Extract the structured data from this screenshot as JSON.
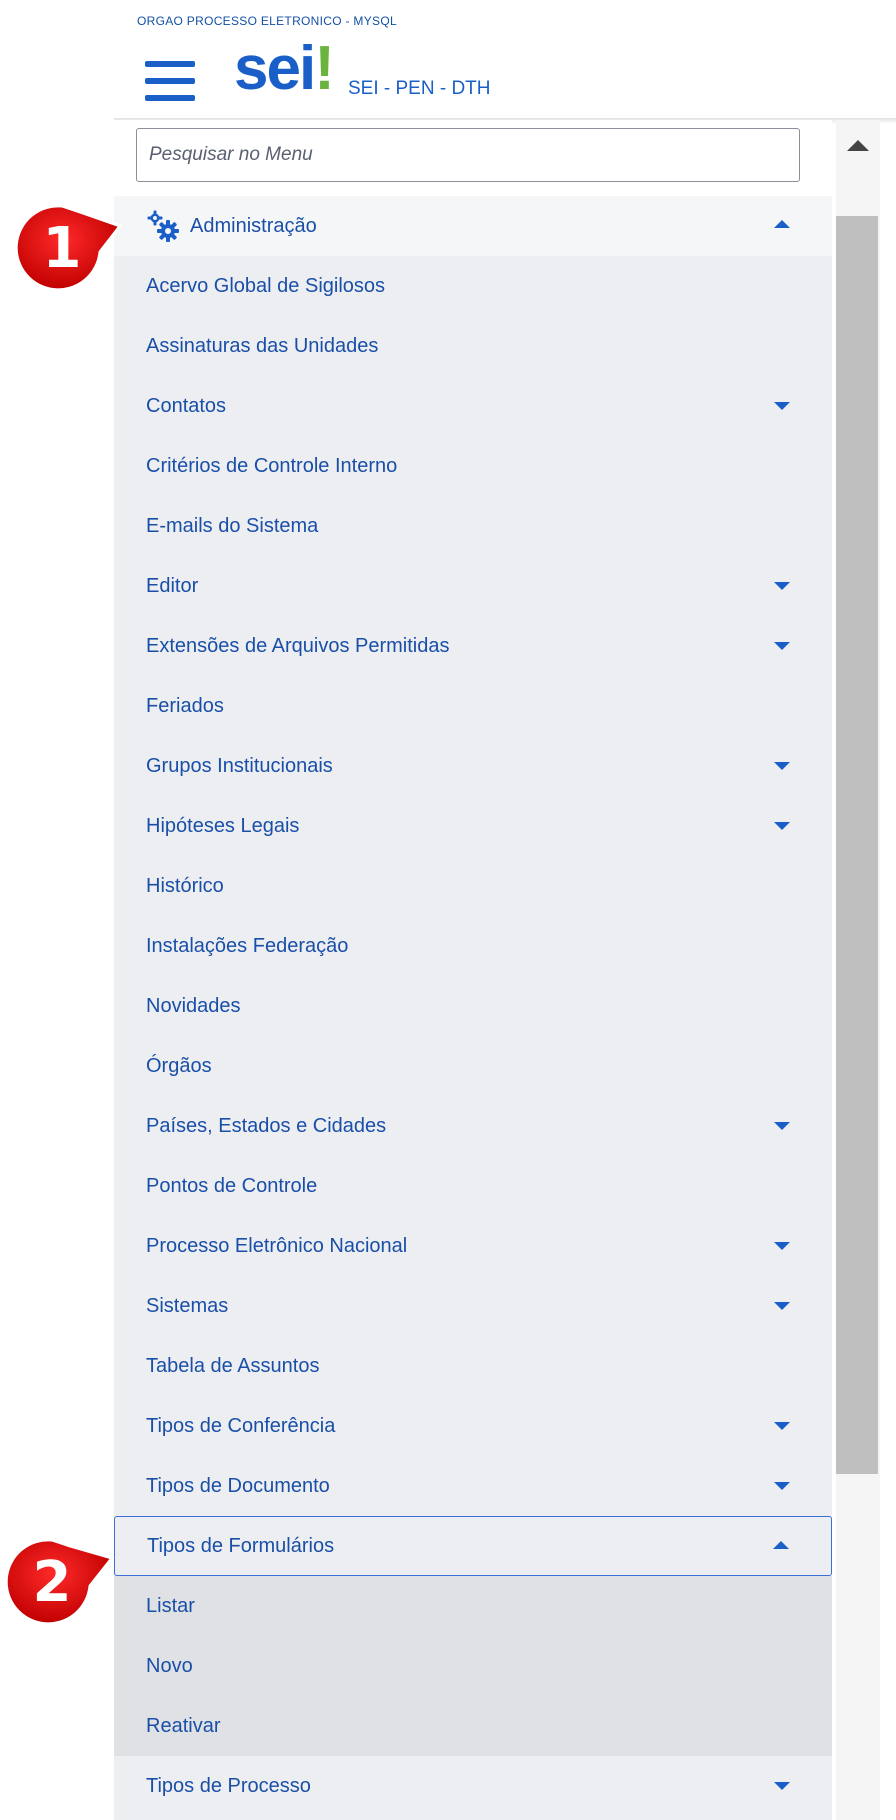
{
  "header": {
    "org_name": "ORGAO PROCESSO ELETRONICO - MYSQL",
    "logo_text": "sei",
    "logo_mark": "!",
    "system_name": "SEI - PEN - DTH",
    "menu_icon": "hamburger-menu-icon"
  },
  "search": {
    "placeholder": "Pesquisar no Menu",
    "value": ""
  },
  "menu": {
    "section": {
      "label": "Administração",
      "icon": "gears-icon",
      "expanded": true
    },
    "items": [
      {
        "label": "Acervo Global de Sigilosos",
        "caret": "none"
      },
      {
        "label": "Assinaturas das Unidades",
        "caret": "none"
      },
      {
        "label": "Contatos",
        "caret": "down"
      },
      {
        "label": "Critérios de Controle Interno",
        "caret": "none"
      },
      {
        "label": "E-mails do Sistema",
        "caret": "none"
      },
      {
        "label": "Editor",
        "caret": "down"
      },
      {
        "label": "Extensões de Arquivos Permitidas",
        "caret": "down"
      },
      {
        "label": "Feriados",
        "caret": "none"
      },
      {
        "label": "Grupos Institucionais",
        "caret": "down"
      },
      {
        "label": "Hipóteses Legais",
        "caret": "down"
      },
      {
        "label": "Histórico",
        "caret": "none"
      },
      {
        "label": "Instalações Federação",
        "caret": "none"
      },
      {
        "label": "Novidades",
        "caret": "none"
      },
      {
        "label": "Órgãos",
        "caret": "none"
      },
      {
        "label": "Países, Estados e Cidades",
        "caret": "down"
      },
      {
        "label": "Pontos de Controle",
        "caret": "none"
      },
      {
        "label": "Processo Eletrônico Nacional",
        "caret": "down"
      },
      {
        "label": "Sistemas",
        "caret": "down"
      },
      {
        "label": "Tabela de Assuntos",
        "caret": "none"
      },
      {
        "label": "Tipos de Conferência",
        "caret": "down"
      },
      {
        "label": "Tipos de Documento",
        "caret": "down"
      }
    ],
    "selected": {
      "label": "Tipos de Formulários",
      "caret": "up",
      "children": [
        "Listar",
        "Novo",
        "Reativar"
      ]
    },
    "after": [
      {
        "label": "Tipos de Processo",
        "caret": "down"
      }
    ]
  },
  "callouts": [
    "1",
    "2"
  ],
  "colors": {
    "link": "#1a4fa8",
    "accent": "#1a5fc8",
    "logo_green": "#6bb33f",
    "callout_red": "#e00000"
  }
}
